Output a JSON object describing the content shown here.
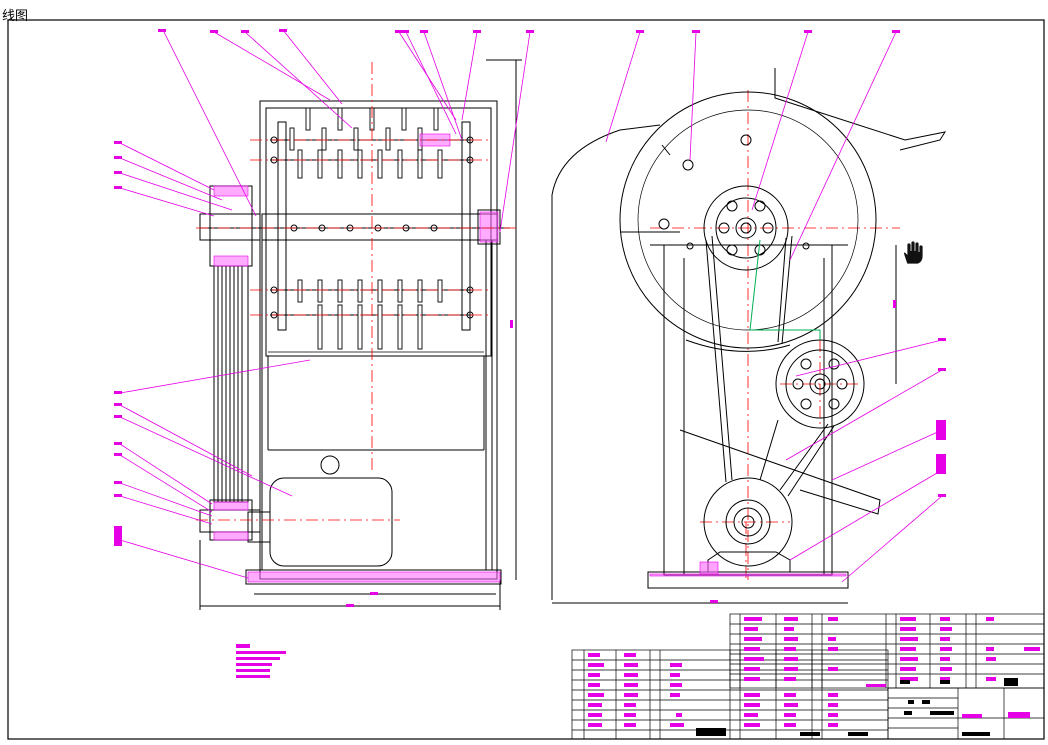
{
  "window": {
    "title_fragment": "线图"
  },
  "drawing": {
    "colors": {
      "outline": "#000000",
      "magenta": "#e600e6",
      "red": "#ff0000",
      "green": "#00b050",
      "frame": "#000000"
    }
  },
  "cursor": {
    "icon": "hand-grab-icon"
  }
}
